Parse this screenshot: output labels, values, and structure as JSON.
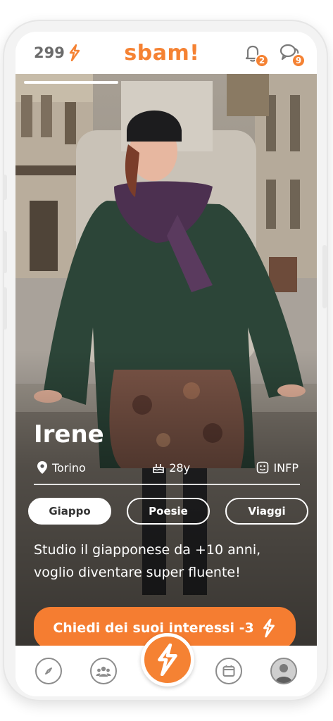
{
  "header": {
    "coins": "299",
    "logo": "sbam!",
    "notifications_count": "2",
    "chats_count": "9"
  },
  "profile": {
    "name": "Irene",
    "city": "Torino",
    "age": "28y",
    "personality": "INFP",
    "tags": [
      "Giappo",
      "Poesie",
      "Viaggi"
    ],
    "bio": "Studio il giapponese da +10 anni, voglio diventare super fluente!"
  },
  "cta": {
    "label": "Chiedi dei suoi interessi -3"
  },
  "icons": {
    "coins": "bolt-icon",
    "notifications": "bell-icon",
    "chats": "chat-bubbles-icon",
    "nav": [
      "compass-icon",
      "people-icon",
      "bolt-icon",
      "calendar-icon",
      "avatar"
    ]
  },
  "colors": {
    "accent": "#f58233",
    "text_muted": "#6b6b6b"
  }
}
